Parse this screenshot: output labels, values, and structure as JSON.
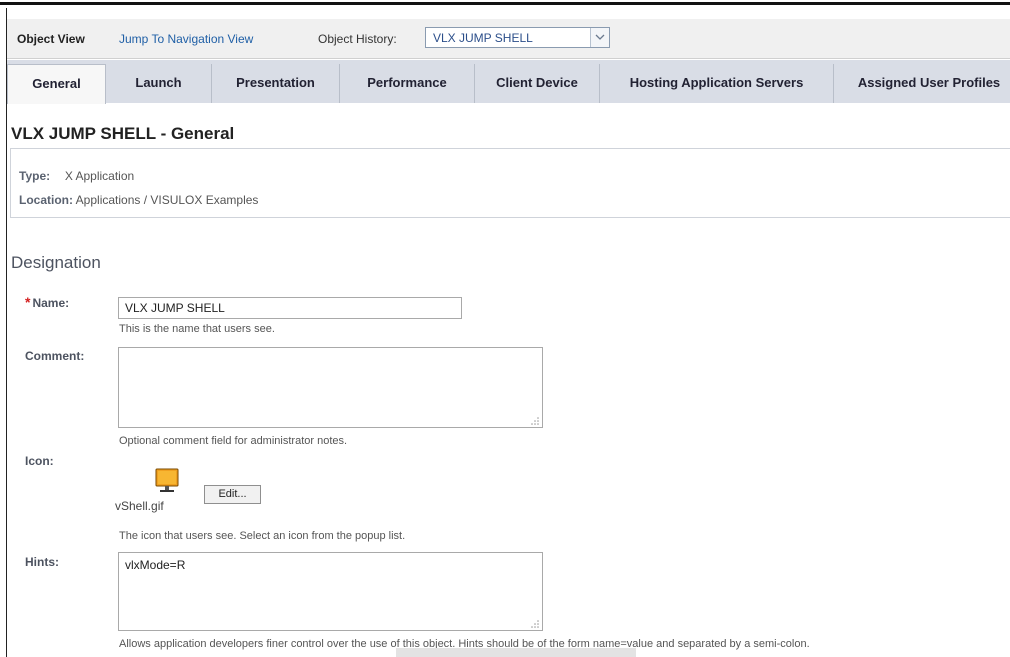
{
  "toolbar": {
    "object_view": "Object View",
    "jump_link": "Jump To Navigation View",
    "history_label": "Object History:",
    "history_value": "VLX JUMP SHELL"
  },
  "tabs": [
    {
      "label": "General",
      "active": true
    },
    {
      "label": "Launch",
      "active": false
    },
    {
      "label": "Presentation",
      "active": false
    },
    {
      "label": "Performance",
      "active": false
    },
    {
      "label": "Client Device",
      "active": false
    },
    {
      "label": "Hosting Application Servers",
      "active": false
    },
    {
      "label": "Assigned User Profiles",
      "active": false
    }
  ],
  "page": {
    "title": "VLX JUMP SHELL - General",
    "type_key": "Type:",
    "type_value": "X Application",
    "location_key": "Location:",
    "location_value": "Applications / VISULOX Examples"
  },
  "designation": {
    "title": "Designation",
    "required_mark": "*",
    "name_label": "Name:",
    "name_value": "VLX JUMP SHELL",
    "name_help": "This is the name that users see.",
    "comment_label": "Comment:",
    "comment_value": "",
    "comment_help": "Optional comment field for administrator notes.",
    "icon_label": "Icon:",
    "icon_file": "vShell.gif",
    "icon_name": "monitor-icon",
    "edit_button": "Edit...",
    "icon_help": "The icon that users see. Select an icon from the popup list.",
    "hints_label": "Hints:",
    "hints_value": "vlxMode=R",
    "hints_help": "Allows application developers finer control over the use of this object. Hints should be of the form name=value and separated by a semi-colon."
  },
  "colors": {
    "link": "#1f5fa6",
    "tab_bar": "#d9dde6",
    "required": "#d42020",
    "monitor": "#f0a020"
  }
}
